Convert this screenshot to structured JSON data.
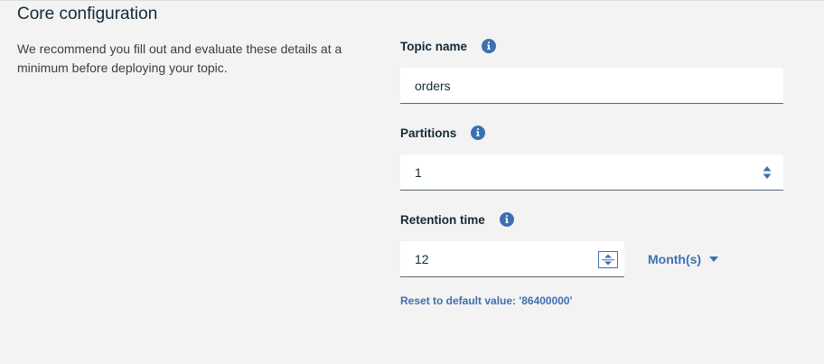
{
  "section": {
    "title": "Core configuration",
    "description": "We recommend you fill out and evaluate these details at a minimum before deploying your topic."
  },
  "fields": {
    "topic_name": {
      "label": "Topic name",
      "value": "orders",
      "info_icon": "info-icon"
    },
    "partitions": {
      "label": "Partitions",
      "value": "1",
      "info_icon": "info-icon"
    },
    "retention_time": {
      "label": "Retention time",
      "value": "12",
      "unit": "Month(s)",
      "info_icon": "info-icon",
      "reset_link": "Reset to default value: '86400000'"
    }
  },
  "colors": {
    "background": "#f3f3f3",
    "input_bg": "#ffffff",
    "accent": "#3d70b2",
    "text": "#152935",
    "info_icon": "#3d70b2"
  }
}
